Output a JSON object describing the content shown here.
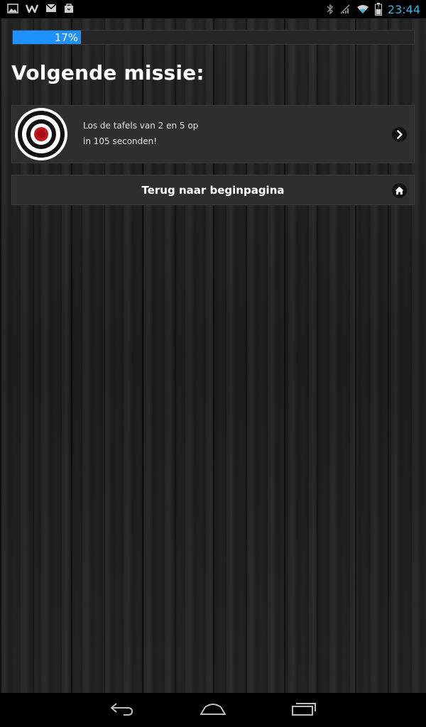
{
  "status_bar": {
    "time": "23:44",
    "left_icons": [
      "gallery-icon",
      "w-app-icon",
      "gmail-icon",
      "shopping-bag-icon"
    ],
    "right_icons": [
      "bluetooth-icon",
      "no-signal-icon",
      "wifi-icon",
      "battery-icon"
    ]
  },
  "progress": {
    "value_percent": 17,
    "label": "17%",
    "color": "#1e90ff"
  },
  "title": "Volgende missie:",
  "mission": {
    "icon": "target-icon",
    "line1": "Los de tafels van 2 en 5 op",
    "line2": "in 105 seconden!",
    "action_icon": "chevron-right-icon"
  },
  "home_button": {
    "label": "Terug naar beginpagina",
    "icon": "home-icon"
  },
  "nav_bar": {
    "buttons": [
      "back-icon",
      "home-icon",
      "recent-apps-icon"
    ]
  }
}
